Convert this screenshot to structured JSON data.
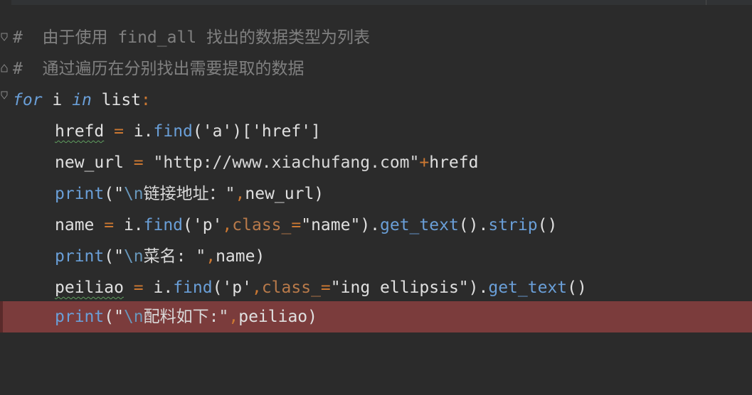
{
  "editor": {
    "lines": [
      {
        "tokens": [
          {
            "t": "#  由于使用 find_all 找出的数据类型为列表",
            "c": "comment"
          }
        ]
      },
      {
        "tokens": [
          {
            "t": "#  通过遍历在分别找出需要提取的数据",
            "c": "comment"
          }
        ]
      },
      {
        "tokens": [
          {
            "t": "for",
            "c": "kw"
          },
          {
            "t": " i ",
            "c": "plain"
          },
          {
            "t": "in",
            "c": "kw"
          },
          {
            "t": " list",
            "c": "plain"
          },
          {
            "t": ":",
            "c": "punc"
          }
        ]
      },
      {
        "tokens": [
          {
            "t": "hrefd",
            "c": "plain wavy"
          },
          {
            "t": " = ",
            "c": "op"
          },
          {
            "t": "i.",
            "c": "plain"
          },
          {
            "t": "find",
            "c": "fn"
          },
          {
            "t": "('a')['href']",
            "c": "plain"
          }
        ]
      },
      {
        "tokens": [
          {
            "t": "new_url",
            "c": "plain"
          },
          {
            "t": " = ",
            "c": "op"
          },
          {
            "t": "\"http://www.xiachufang.com\"",
            "c": "str"
          },
          {
            "t": "+",
            "c": "op"
          },
          {
            "t": "hrefd",
            "c": "plain"
          }
        ]
      },
      {
        "tokens": [
          {
            "t": "print",
            "c": "builtin"
          },
          {
            "t": "(\"",
            "c": "plain"
          },
          {
            "t": "\\n",
            "c": "esc"
          },
          {
            "t": "链接地址：\"",
            "c": "str"
          },
          {
            "t": ",",
            "c": "punc"
          },
          {
            "t": "new_url)",
            "c": "plain"
          }
        ]
      },
      {
        "tokens": [
          {
            "t": "name",
            "c": "plain"
          },
          {
            "t": " = ",
            "c": "op"
          },
          {
            "t": "i.",
            "c": "plain"
          },
          {
            "t": "find",
            "c": "fn"
          },
          {
            "t": "('p'",
            "c": "plain"
          },
          {
            "t": ",",
            "c": "punc"
          },
          {
            "t": "class_",
            "c": "param"
          },
          {
            "t": "=",
            "c": "op"
          },
          {
            "t": "\"name\").",
            "c": "plain"
          },
          {
            "t": "get_text",
            "c": "fn"
          },
          {
            "t": "().",
            "c": "plain"
          },
          {
            "t": "strip",
            "c": "fn"
          },
          {
            "t": "()",
            "c": "plain"
          }
        ]
      },
      {
        "tokens": [
          {
            "t": "print",
            "c": "builtin"
          },
          {
            "t": "(\"",
            "c": "plain"
          },
          {
            "t": "\\n",
            "c": "esc"
          },
          {
            "t": "菜名: \"",
            "c": "str"
          },
          {
            "t": ",",
            "c": "punc"
          },
          {
            "t": "name)",
            "c": "plain"
          }
        ]
      },
      {
        "tokens": [
          {
            "t": "peiliao",
            "c": "plain wavy"
          },
          {
            "t": " = ",
            "c": "op"
          },
          {
            "t": "i.",
            "c": "plain"
          },
          {
            "t": "find",
            "c": "fn"
          },
          {
            "t": "('p'",
            "c": "plain"
          },
          {
            "t": ",",
            "c": "punc"
          },
          {
            "t": "class_",
            "c": "param"
          },
          {
            "t": "=",
            "c": "op"
          },
          {
            "t": "\"ing ellipsis\").",
            "c": "plain"
          },
          {
            "t": "get_text",
            "c": "fn"
          },
          {
            "t": "()",
            "c": "plain"
          }
        ]
      },
      {
        "tokens": [
          {
            "t": "print",
            "c": "builtin"
          },
          {
            "t": "(\"",
            "c": "plain"
          },
          {
            "t": "\\n",
            "c": "esc"
          },
          {
            "t": "配料如下:\"",
            "c": "str"
          },
          {
            "t": ",",
            "c": "punc"
          },
          {
            "t": "peiliao)",
            "c": "plain"
          }
        ]
      }
    ],
    "colors": {
      "background": "#2b2b2b",
      "current_line": "#7b3c3c",
      "comment": "#808080",
      "keyword": "#6a9fd8",
      "operator": "#cc7832"
    }
  }
}
